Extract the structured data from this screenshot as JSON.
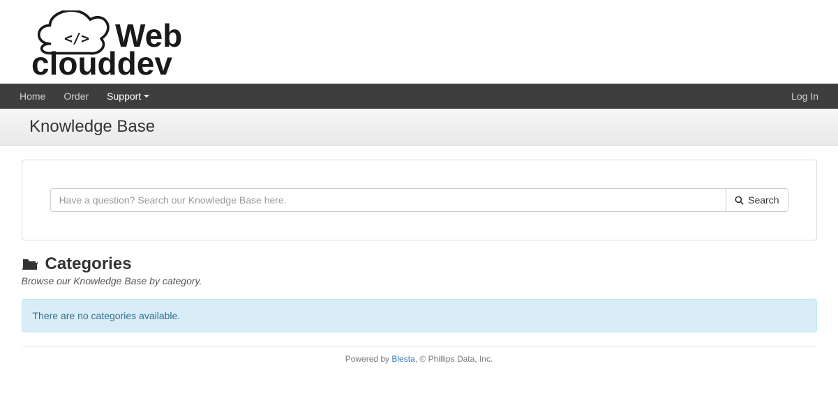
{
  "brand": {
    "line1": "Web",
    "line2": "clouddev"
  },
  "nav": {
    "home": "Home",
    "order": "Order",
    "support": "Support",
    "login": "Log In"
  },
  "page_title": "Knowledge Base",
  "search": {
    "placeholder": "Have a question? Search our Knowledge Base here.",
    "button": "Search"
  },
  "categories": {
    "heading": "Categories",
    "subtitle": "Browse our Knowledge Base by category.",
    "empty_message": "There are no categories available."
  },
  "footer": {
    "powered_by_prefix": "Powered by ",
    "powered_by_link": "Blesta",
    "suffix": ", © Phillips Data, Inc."
  }
}
